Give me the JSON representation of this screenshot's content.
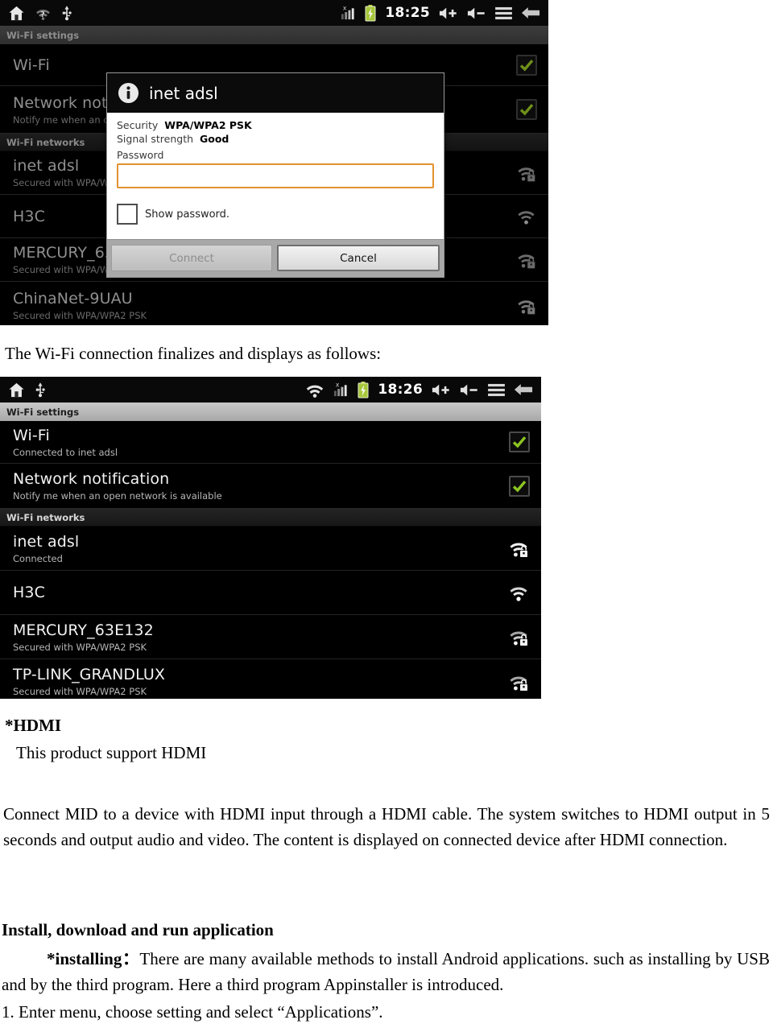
{
  "screenshot_1": {
    "name": "wifi-password-dialog-screenshot",
    "statusbar": {
      "left_icons": [
        "home-icon",
        "wifi-searching-icon",
        "usb-icon"
      ],
      "right_icons": [
        "signal-bars-icon",
        "battery-charging-icon"
      ],
      "clock": "18:25",
      "trailing_icons": [
        "volume-up-icon",
        "volume-down-icon",
        "menu-icon",
        "back-icon"
      ]
    },
    "titlebar": "Wi-Fi settings",
    "rows": [
      {
        "title": "Wi-Fi",
        "sub": "",
        "control": "checkbox-checked"
      },
      {
        "title": "Network notification",
        "sub": "Notify me when an open network is available",
        "control": "checkbox-checked"
      }
    ],
    "section_header": "Wi-Fi networks",
    "networks": [
      {
        "ssid": "inet adsl",
        "sub": "Secured with WPA/WPA2 PSK",
        "icon": "wifi-secured-icon"
      },
      {
        "ssid": "H3C",
        "sub": "",
        "icon": "wifi-open-icon"
      },
      {
        "ssid": "MERCURY_63E132",
        "sub": "Secured with WPA/WPA2 PSK",
        "icon": "wifi-secured-icon"
      },
      {
        "ssid": "ChinaNet-9UAU",
        "sub": "Secured with WPA/WPA2 PSK",
        "icon": "wifi-secured-icon"
      }
    ],
    "dialog": {
      "title": "inet adsl",
      "icon": "info-icon",
      "security_label": "Security",
      "security_value": "WPA/WPA2 PSK",
      "signal_label": "Signal strength",
      "signal_value": "Good",
      "password_label": "Password",
      "password_value": "",
      "show_password_label": "Show password.",
      "show_password_checked": false,
      "connect_label": "Connect",
      "connect_enabled": false,
      "cancel_label": "Cancel",
      "focus_color": "#e2922f"
    }
  },
  "caption_1": "The Wi-Fi connection finalizes and displays as follows:",
  "screenshot_2": {
    "name": "wifi-connected-screenshot",
    "statusbar": {
      "left_icons": [
        "home-icon",
        "usb-icon"
      ],
      "right_icons": [
        "wifi-connected-icon",
        "signal-bars-icon",
        "battery-charging-icon"
      ],
      "clock": "18:26",
      "trailing_icons": [
        "volume-up-icon",
        "volume-down-icon",
        "menu-icon",
        "back-icon"
      ]
    },
    "titlebar": "Wi-Fi settings",
    "rows": [
      {
        "title": "Wi-Fi",
        "sub": "Connected to inet adsl",
        "control": "checkbox-checked"
      },
      {
        "title": "Network notification",
        "sub": "Notify me when an open network is available",
        "control": "checkbox-checked"
      }
    ],
    "section_header": "Wi-Fi networks",
    "networks": [
      {
        "ssid": "inet adsl",
        "sub": "Connected",
        "icon": "wifi-secured-icon"
      },
      {
        "ssid": "H3C",
        "sub": "",
        "icon": "wifi-open-icon"
      },
      {
        "ssid": "MERCURY_63E132",
        "sub": "Secured with WPA/WPA2 PSK",
        "icon": "wifi-secured-icon"
      },
      {
        "ssid": "TP-LINK_GRANDLUX",
        "sub": "Secured with WPA/WPA2 PSK",
        "icon": "wifi-secured-icon"
      }
    ]
  },
  "doc": {
    "hdmi_heading": "*HDMI",
    "hdmi_line": "This product support HDMI",
    "hdmi_para": "Connect MID to a device with HDMI input through a HDMI cable. The system switches to HDMI output in 5 seconds and output audio and video. The content is displayed on connected device after HDMI connection.",
    "install_heading": "Install, download and run application",
    "installing_label": "*installing：",
    "installing_para": "There are many available methods to install Android applications. such as installing by USB and by the third program. Here a third program Appinstaller is introduced.",
    "step_1": "1. Enter menu, choose setting and select “Applications”."
  }
}
